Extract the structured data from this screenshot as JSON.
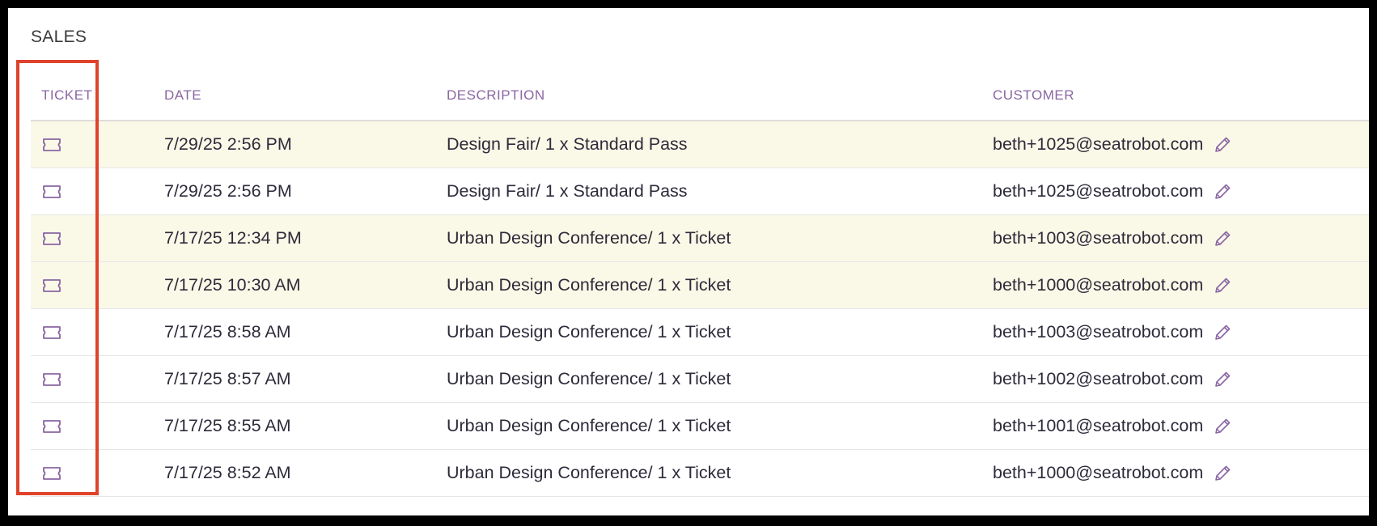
{
  "section": {
    "title": "SALES"
  },
  "table": {
    "headers": {
      "ticket": "TICKET",
      "date": "DATE",
      "description": "DESCRIPTION",
      "customer": "CUSTOMER"
    },
    "rows": [
      {
        "date": "7/29/25 2:56 PM",
        "description": "Design Fair/ 1 x Standard Pass",
        "customer": "beth+1025@seatrobot.com",
        "highlighted": true
      },
      {
        "date": "7/29/25 2:56 PM",
        "description": "Design Fair/ 1 x Standard Pass",
        "customer": "beth+1025@seatrobot.com",
        "highlighted": false
      },
      {
        "date": "7/17/25 12:34 PM",
        "description": "Urban Design Conference/ 1 x Ticket",
        "customer": "beth+1003@seatrobot.com",
        "highlighted": true
      },
      {
        "date": "7/17/25 10:30 AM",
        "description": "Urban Design Conference/ 1 x Ticket",
        "customer": "beth+1000@seatrobot.com",
        "highlighted": true
      },
      {
        "date": "7/17/25 8:58 AM",
        "description": "Urban Design Conference/ 1 x Ticket",
        "customer": "beth+1003@seatrobot.com",
        "highlighted": false
      },
      {
        "date": "7/17/25 8:57 AM",
        "description": "Urban Design Conference/ 1 x Ticket",
        "customer": "beth+1002@seatrobot.com",
        "highlighted": false
      },
      {
        "date": "7/17/25 8:55 AM",
        "description": "Urban Design Conference/ 1 x Ticket",
        "customer": "beth+1001@seatrobot.com",
        "highlighted": false
      },
      {
        "date": "7/17/25 8:52 AM",
        "description": "Urban Design Conference/ 1 x Ticket",
        "customer": "beth+1000@seatrobot.com",
        "highlighted": false
      }
    ]
  },
  "icons": {
    "ticket": "ticket-icon",
    "edit": "pencil-icon"
  },
  "colors": {
    "header_text": "#8a66a3",
    "icon": "#8a66a3",
    "row_highlight": "#faf8e7",
    "annotation_box": "#e0432b"
  }
}
